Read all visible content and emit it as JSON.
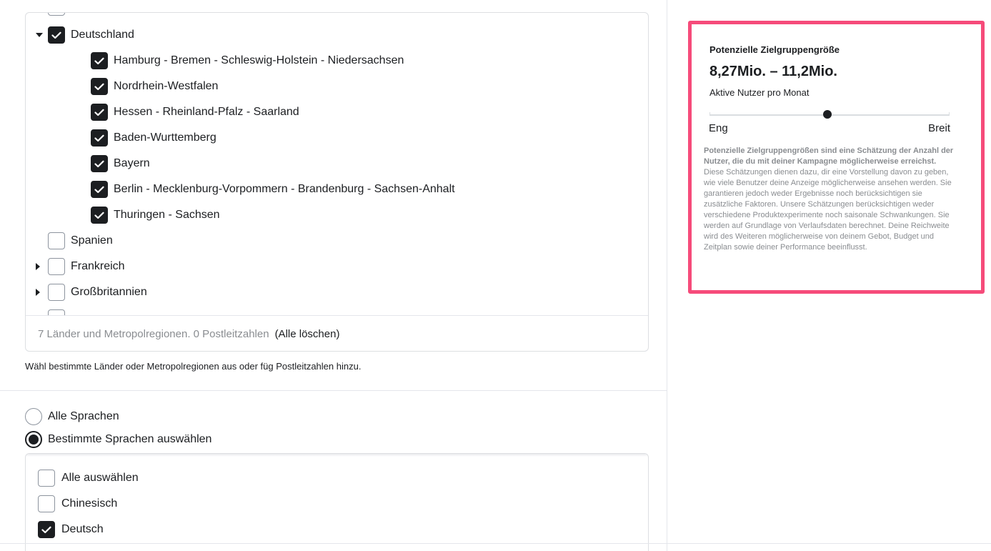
{
  "locations": {
    "tree": [
      {
        "label": "Deutschland",
        "checked": true,
        "expandable": true,
        "expanded": true
      },
      {
        "label": "Hamburg - Bremen - Schleswig-Holstein - Niedersachsen",
        "checked": true
      },
      {
        "label": "Nordrhein-Westfalen",
        "checked": true
      },
      {
        "label": "Hessen - Rheinland-Pfalz - Saarland",
        "checked": true
      },
      {
        "label": "Baden-Wurttemberg",
        "checked": true
      },
      {
        "label": "Bayern",
        "checked": true
      },
      {
        "label": "Berlin - Mecklenburg-Vorpommern - Brandenburg - Sachsen-Anhalt",
        "checked": true
      },
      {
        "label": "Thuringen - Sachsen",
        "checked": true
      },
      {
        "label": "Spanien",
        "checked": false
      },
      {
        "label": "Frankreich",
        "checked": false,
        "expandable": true,
        "expanded": false
      },
      {
        "label": "Großbritannien",
        "checked": false,
        "expandable": true,
        "expanded": false
      }
    ],
    "footer_summary": "7 Länder und Metropolregionen. 0 Postleitzahlen",
    "clear_all": "(Alle löschen)",
    "helper": "Wähl bestimmte Länder oder Metropolregionen aus oder füg Postleitzahlen hinzu."
  },
  "languages": {
    "options": [
      {
        "label": "Alle Sprachen",
        "selected": false
      },
      {
        "label": "Bestimmte Sprachen auswählen",
        "selected": true
      }
    ],
    "list": [
      {
        "label": "Alle auswählen",
        "checked": false
      },
      {
        "label": "Chinesisch",
        "checked": false
      },
      {
        "label": "Deutsch",
        "checked": true
      }
    ]
  },
  "audience": {
    "title": "Potenzielle Zielgruppengröße",
    "range": "8,27Mio. – 11,2Mio.",
    "subtitle": "Aktive Nutzer pro Monat",
    "meter_position": 0.49,
    "min_label": "Eng",
    "max_label": "Breit",
    "disclaimer_bold": "Potenzielle Zielgruppengrößen sind eine Schätzung der Anzahl der Nutzer, die du mit deiner Kampagne möglicherweise erreichst.",
    "disclaimer_text": "Diese Schätzungen dienen dazu, dir eine Vorstellung davon zu geben, wie viele Benutzer deine Anzeige möglicherweise ansehen werden. Sie garantieren jedoch weder Ergebnisse noch berücksichtigen sie zusätzliche Faktoren. Unsere Schätzungen berücksichtigen weder verschiedene Produktexperimente noch saisonale Schwankungen. Sie werden auf Grundlage von Verlaufsdaten berechnet. Deine Reichweite wird des Weiteren möglicherweise von deinem Gebot, Budget und Zeitplan sowie deiner Performance beeinflusst.",
    "highlight_color": "#f64b7a"
  }
}
